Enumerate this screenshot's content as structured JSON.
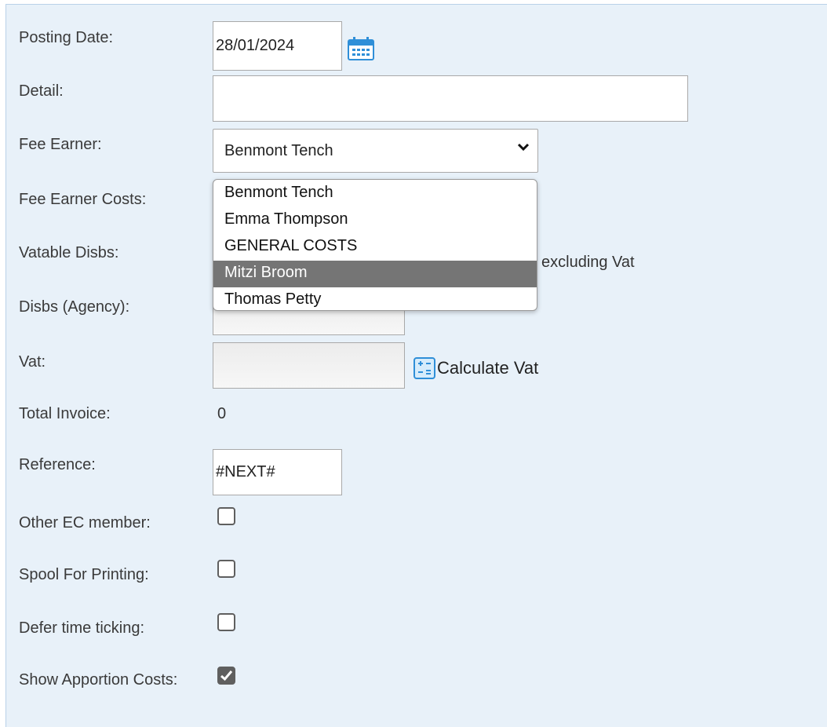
{
  "labels": {
    "posting_date": "Posting Date:",
    "detail": "Detail:",
    "fee_earner": "Fee Earner:",
    "fee_earner_costs": "Fee Earner Costs:",
    "vatable_disbs": "Vatable Disbs:",
    "disbs_agency": "Disbs (Agency):",
    "vat": "Vat:",
    "total_invoice": "Total Invoice:",
    "reference": "Reference:",
    "other_ec_member": "Other EC member:",
    "spool_for_printing": "Spool For Printing:",
    "defer_time_ticking": "Defer time ticking:",
    "show_apportion_costs": "Show Apportion Costs:"
  },
  "fields": {
    "posting_date": "28/01/2024",
    "detail": "",
    "fee_earner_selected": "Benmont Tench",
    "excluding_vat": "excluding Vat",
    "vat": "",
    "total_invoice": "0",
    "reference": "#NEXT#",
    "calculate_vat": "Calculate Vat"
  },
  "fee_earner_options": [
    "Benmont Tench",
    "Emma Thompson",
    "GENERAL COSTS",
    "Mitzi Broom",
    "Thomas Petty"
  ],
  "highlighted_option": "Mitzi Broom",
  "checkboxes": {
    "other_ec_member": false,
    "spool_for_printing": false,
    "defer_time_ticking": false,
    "show_apportion_costs": true
  },
  "icons": {
    "calendar": "calendar-icon",
    "calculator": "calculator-icon",
    "dropdown": "chevron-down-icon"
  },
  "colors": {
    "panel_background": "#e8f1f9",
    "highlight": "#757575",
    "icon_blue": "#2f8fd8"
  }
}
